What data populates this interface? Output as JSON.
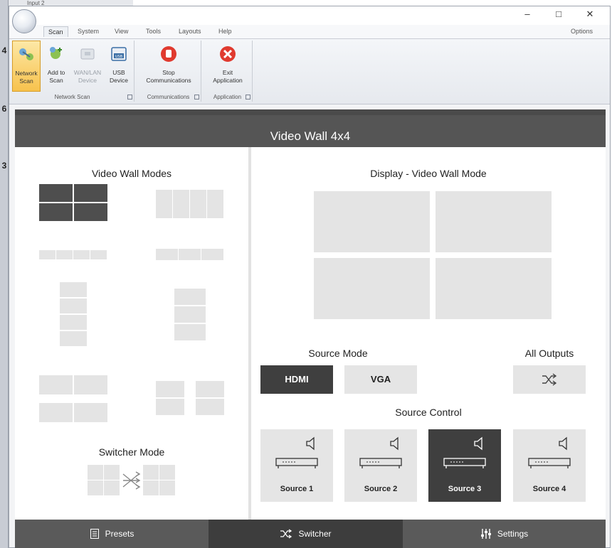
{
  "background": {
    "top_label": "Input 2",
    "edge_numbers": [
      "4",
      "6",
      "3"
    ]
  },
  "window": {
    "controls": [
      "–",
      "□",
      "✕"
    ],
    "tabs": [
      "Scan",
      "System",
      "View",
      "Tools",
      "Layouts",
      "Help"
    ],
    "active_tab": "Scan",
    "options_label": "Options"
  },
  "ribbon": {
    "groups": [
      {
        "label": "Network Scan",
        "buttons": [
          {
            "line1": "Network",
            "line2": "Scan",
            "icon": "network-scan-icon",
            "state": "selected"
          },
          {
            "line1": "Add to",
            "line2": "Scan",
            "icon": "add-to-scan-icon",
            "state": "normal"
          },
          {
            "line1": "WAN/LAN",
            "line2": "Device",
            "icon": "wan-lan-device-icon",
            "state": "disabled"
          },
          {
            "line1": "USB",
            "line2": "Device",
            "icon": "usb-device-icon",
            "state": "normal"
          }
        ]
      },
      {
        "label": "Communications",
        "buttons": [
          {
            "line1": "Stop",
            "line2": "Communications",
            "icon": "stop-hand-icon",
            "state": "normal"
          }
        ]
      },
      {
        "label": "Application",
        "buttons": [
          {
            "line1": "Exit",
            "line2": "Application",
            "icon": "exit-icon",
            "state": "normal"
          }
        ]
      }
    ]
  },
  "panel": {
    "title": "Video Wall 4x4",
    "left": {
      "modes_title": "Video Wall Modes",
      "switcher_title": "Switcher Mode"
    },
    "right": {
      "display_title": "Display - Video Wall Mode",
      "source_mode_title": "Source Mode",
      "source_mode_buttons": [
        {
          "label": "HDMI",
          "selected": true
        },
        {
          "label": "VGA",
          "selected": false
        }
      ],
      "all_outputs_title": "All Outputs",
      "all_outputs_icon": "shuffle-icon",
      "source_control_title": "Source Control",
      "sources": [
        {
          "label": "Source 1",
          "selected": false
        },
        {
          "label": "Source 2",
          "selected": false
        },
        {
          "label": "Source 3",
          "selected": true
        },
        {
          "label": "Source 4",
          "selected": false
        }
      ]
    }
  },
  "bottom_nav": [
    {
      "label": "Presets",
      "icon": "presets-icon",
      "active": false
    },
    {
      "label": "Switcher",
      "icon": "shuffle-icon",
      "active": true
    },
    {
      "label": "Settings",
      "icon": "sliders-icon",
      "active": false
    }
  ],
  "colors": {
    "header_bg": "#555555",
    "selected_dark": "#3f3f3f",
    "tile_light": "#e4e4e4",
    "ribbon_selected": "#f7c24d"
  }
}
